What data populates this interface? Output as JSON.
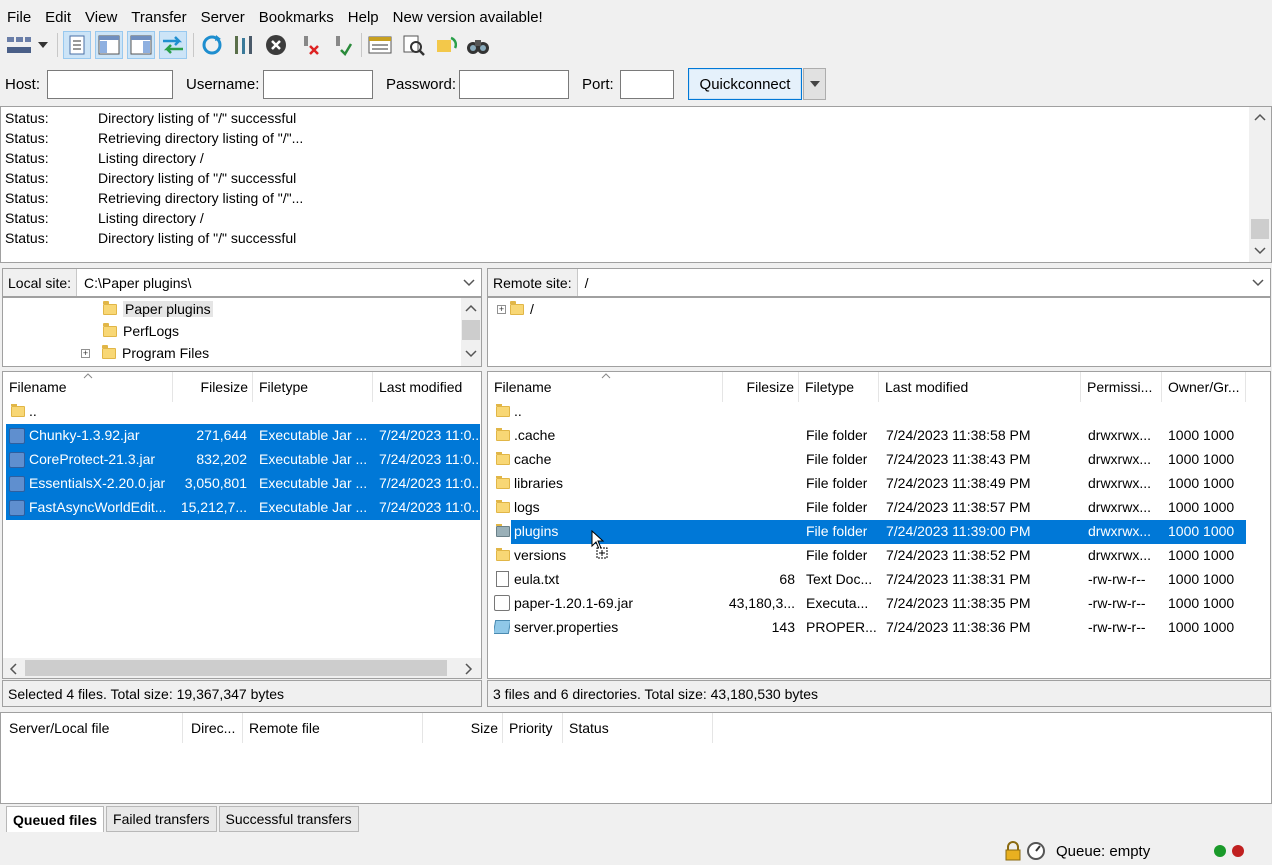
{
  "menu": [
    "File",
    "Edit",
    "View",
    "Transfer",
    "Server",
    "Bookmarks",
    "Help",
    "New version available!"
  ],
  "icons": {
    "toolbar": [
      "site-manager-icon",
      "dropdown-arrow-icon",
      "message-log-icon",
      "local-tree-icon",
      "remote-tree-icon",
      "transfer-queue-icon",
      "refresh-icon",
      "process-queue-icon",
      "cancel-icon",
      "disconnect-icon",
      "reconnect-icon",
      "directory-filter-icon",
      "compare-icon",
      "sync-browse-icon",
      "search-icon"
    ]
  },
  "quickconnect": {
    "host_label": "Host:",
    "username_label": "Username:",
    "password_label": "Password:",
    "port_label": "Port:",
    "button": "Quickconnect",
    "host": "",
    "username": "",
    "password": "",
    "port": ""
  },
  "log": [
    {
      "k": "Status:",
      "v": "Directory listing of \"/\" successful"
    },
    {
      "k": "Status:",
      "v": "Retrieving directory listing of \"/\"..."
    },
    {
      "k": "Status:",
      "v": "Listing directory /"
    },
    {
      "k": "Status:",
      "v": "Directory listing of \"/\" successful"
    },
    {
      "k": "Status:",
      "v": "Retrieving directory listing of \"/\"..."
    },
    {
      "k": "Status:",
      "v": "Listing directory /"
    },
    {
      "k": "Status:",
      "v": "Directory listing of \"/\" successful"
    }
  ],
  "local": {
    "site_label": "Local site:",
    "path": "C:\\Paper plugins\\",
    "tree": [
      "Paper plugins",
      "PerfLogs",
      "Program Files"
    ],
    "headers": [
      "Filename",
      "Filesize",
      "Filetype",
      "Last modified"
    ],
    "files": [
      {
        "name": "..",
        "size": "",
        "type": "",
        "modified": "",
        "icon": "folder"
      },
      {
        "name": "Chunky-1.3.92.jar",
        "size": "271,644",
        "type": "Executable Jar ...",
        "modified": "7/24/2023 11:0...",
        "icon": "jar"
      },
      {
        "name": "CoreProtect-21.3.jar",
        "size": "832,202",
        "type": "Executable Jar ...",
        "modified": "7/24/2023 11:0...",
        "icon": "jar"
      },
      {
        "name": "EssentialsX-2.20.0.jar",
        "size": "3,050,801",
        "type": "Executable Jar ...",
        "modified": "7/24/2023 11:0...",
        "icon": "jar"
      },
      {
        "name": "FastAsyncWorldEdit...",
        "size": "15,212,7...",
        "type": "Executable Jar ...",
        "modified": "7/24/2023 11:0...",
        "icon": "jar"
      }
    ],
    "status": "Selected 4 files. Total size: 19,367,347 bytes"
  },
  "remote": {
    "site_label": "Remote site:",
    "path": "/",
    "tree": [
      "/"
    ],
    "headers": [
      "Filename",
      "Filesize",
      "Filetype",
      "Last modified",
      "Permissi...",
      "Owner/Gr..."
    ],
    "files": [
      {
        "name": "..",
        "size": "",
        "type": "",
        "modified": "",
        "perm": "",
        "owner": "",
        "icon": "folder"
      },
      {
        "name": ".cache",
        "size": "",
        "type": "File folder",
        "modified": "7/24/2023 11:38:58 PM",
        "perm": "drwxrwx...",
        "owner": "1000 1000",
        "icon": "folder"
      },
      {
        "name": "cache",
        "size": "",
        "type": "File folder",
        "modified": "7/24/2023 11:38:43 PM",
        "perm": "drwxrwx...",
        "owner": "1000 1000",
        "icon": "folder"
      },
      {
        "name": "libraries",
        "size": "",
        "type": "File folder",
        "modified": "7/24/2023 11:38:49 PM",
        "perm": "drwxrwx...",
        "owner": "1000 1000",
        "icon": "folder"
      },
      {
        "name": "logs",
        "size": "",
        "type": "File folder",
        "modified": "7/24/2023 11:38:57 PM",
        "perm": "drwxrwx...",
        "owner": "1000 1000",
        "icon": "folder"
      },
      {
        "name": "plugins",
        "size": "",
        "type": "File folder",
        "modified": "7/24/2023 11:39:00 PM",
        "perm": "drwxrwx...",
        "owner": "1000 1000",
        "icon": "folder"
      },
      {
        "name": "versions",
        "size": "",
        "type": "File folder",
        "modified": "7/24/2023 11:38:52 PM",
        "perm": "drwxrwx...",
        "owner": "1000 1000",
        "icon": "folder"
      },
      {
        "name": "eula.txt",
        "size": "68",
        "type": "Text Doc...",
        "modified": "7/24/2023 11:38:31 PM",
        "perm": "-rw-rw-r--",
        "owner": "1000 1000",
        "icon": "text"
      },
      {
        "name": "paper-1.20.1-69.jar",
        "size": "43,180,3...",
        "type": "Executa...",
        "modified": "7/24/2023 11:38:35 PM",
        "perm": "-rw-rw-r--",
        "owner": "1000 1000",
        "icon": "jar"
      },
      {
        "name": "server.properties",
        "size": "143",
        "type": "PROPER...",
        "modified": "7/24/2023 11:38:36 PM",
        "perm": "-rw-rw-r--",
        "owner": "1000 1000",
        "icon": "properties"
      }
    ],
    "status": "3 files and 6 directories. Total size: 43,180,530 bytes"
  },
  "queue": {
    "headers": [
      "Server/Local file",
      "Direc...",
      "Remote file",
      "Size",
      "Priority",
      "Status"
    ],
    "tabs": [
      "Queued files",
      "Failed transfers",
      "Successful transfers"
    ],
    "status": "Queue: empty"
  },
  "colors": {
    "selection": "#0078d7",
    "folder": "#f8d775"
  }
}
